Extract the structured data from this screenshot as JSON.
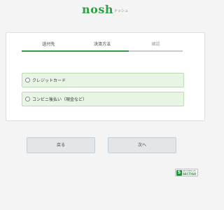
{
  "header": {
    "logo_main": "nosh",
    "logo_sub": "ナッシュ"
  },
  "steps": [
    {
      "label": "送付先",
      "state": "completed"
    },
    {
      "label": "決済方法",
      "state": "current"
    },
    {
      "label": "確認",
      "state": "upcoming"
    }
  ],
  "payment_options": [
    {
      "label": "クレジットカード",
      "selected": false
    },
    {
      "label": "コンビニ後払い（現金など）",
      "selected": false
    }
  ],
  "buttons": {
    "back_label": "戻る",
    "next_label": "次へ"
  },
  "security_badge": {
    "icon": "S",
    "line1": "SECURED BY",
    "line2": "SECTIGO"
  },
  "colors": {
    "brand": "#2f9e46",
    "option_bg": "#e8f5e4",
    "inactive_step": "#cccccc",
    "button_bg": "#e3e6e9"
  }
}
